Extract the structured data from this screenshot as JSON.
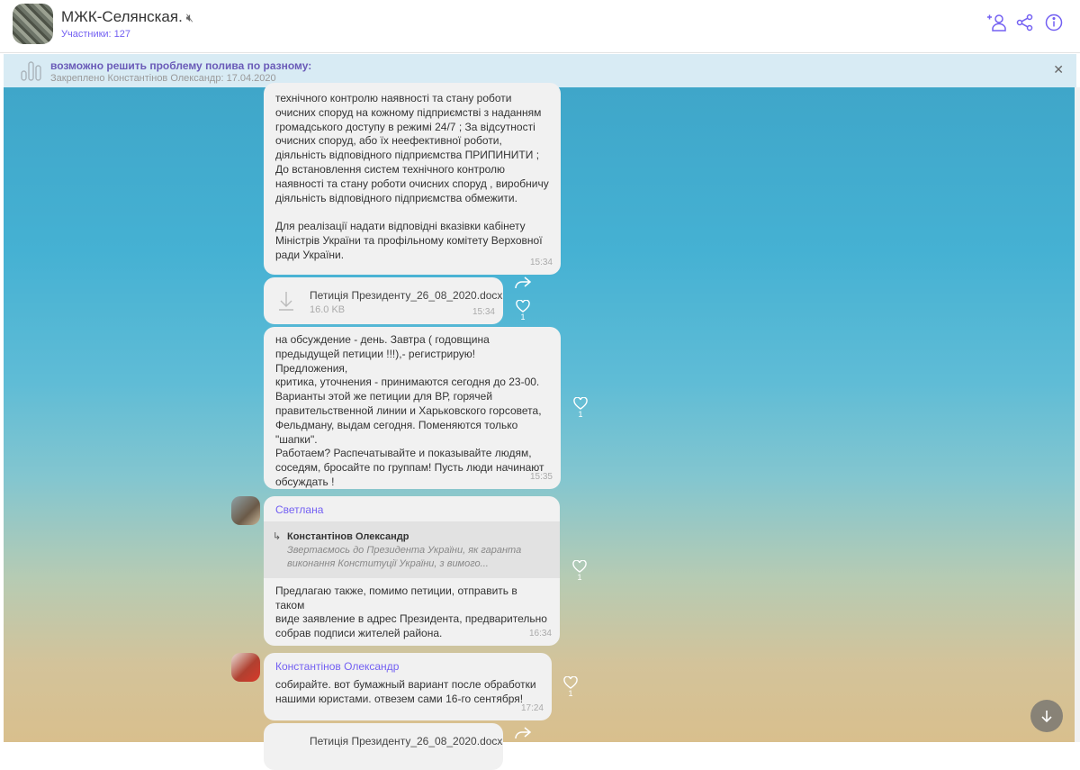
{
  "header": {
    "title": "МЖК-Селянская.",
    "members": "Участники: 127"
  },
  "pinned": {
    "text": "возможно решить проблему полива по разному:",
    "meta": "Закреплено Константінов Олександр: 17.04.2020"
  },
  "messages": [
    {
      "text": "технічного контролю наявності та стану роботи\nочисних споруд на кожному підприємстві з наданням\nгромадського доступу в режимі 24/7 ; За відсутності\nочисних споруд, або їх неефективної роботи,\nдіяльність відповідного підприємства ПРИПИНИТИ ;\nДо встановлення систем технічного контролю\nнаявності та стану роботи очисних споруд , виробничу\nдіяльність відповідного підприємства обмежити.\n\nДля реалізації надати відповідні вказівки кабінету\nМіністрів України та профільному комітету Верховної\nради України.",
      "time": "15:34"
    },
    {
      "file_name": "Петиція Президенту_26_08_2020.docx",
      "file_size": "16.0 KB",
      "time": "15:34",
      "likes": "1"
    },
    {
      "text": "на обсуждение - день. Завтра ( годовщина\nпредыдущей петиции !!!),- регистрирую! Предложения,\nкритика, уточнения - принимаются сегодня до 23-00.\nВарианты этой же петиции для ВР, горячей\nправительственной линии и Харьковского горсовета,\nФельдману, выдам сегодня. Поменяются только\n\"шапки\".\nРаботаем? Распечатывайте и показывайте людям,\nсоседям, бросайте по группам! Пусть люди начинают\nобсуждать !",
      "time": "15:35",
      "likes": "1"
    },
    {
      "sender": "Светлана",
      "quote_author": "Константінов Олександр",
      "quote_text": "Звертаємось до Президента України, як гаранта\nвиконання Конституції України, з вимого...",
      "text": "Предлагаю также, помимо петиции, отправить в таком\nвиде заявление в адрес Президента, предварительно\nсобрав подписи жителей района.",
      "time": "16:34",
      "likes": "1"
    },
    {
      "sender": "Константінов Олександр",
      "text": "собирайте. вот бумажный вариант после обработки\nнашими юристами. отвезем сами 16-го сентября!",
      "time": "17:24",
      "likes": "1"
    },
    {
      "file_name": "Петиція Президенту_26_08_2020.docx"
    }
  ]
}
